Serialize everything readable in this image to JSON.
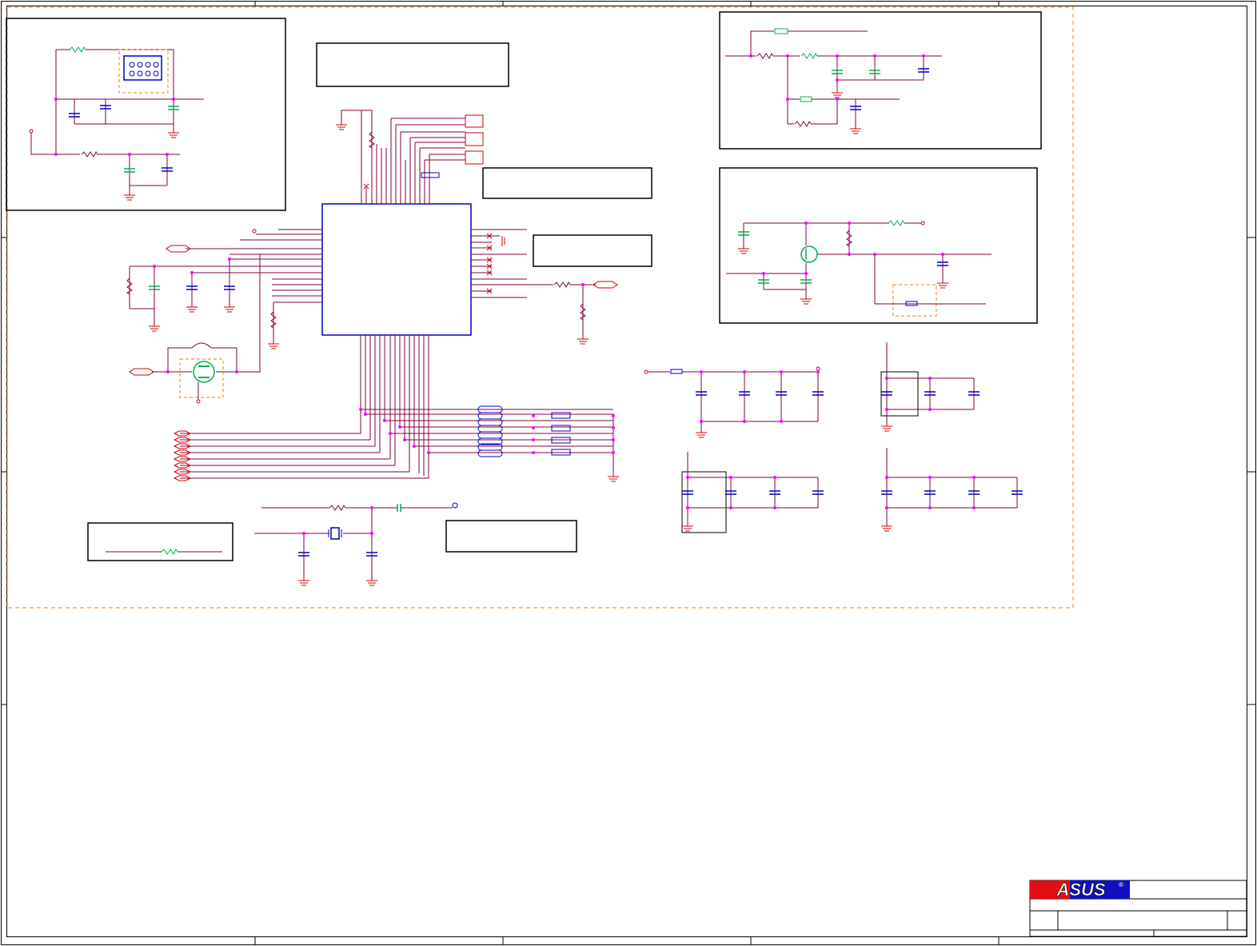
{
  "sheet": {
    "title": "",
    "company_logo": "ASUS",
    "registered_mark": "®"
  },
  "colors": {
    "wire": "#800040",
    "net_label": "#d00000",
    "part": "#0000c0",
    "part_alt": "#00b050",
    "junction": "#ff00ff",
    "frame": "#000000",
    "dashed_group": "#f08000",
    "logo_red": "#e01010",
    "logo_blue": "#1010c0"
  },
  "icons": {
    "resistor": "resistor-icon",
    "capacitor": "capacitor-icon",
    "ground": "ground-icon",
    "inductor": "inductor-icon",
    "transistor": "transistor-icon",
    "crystal": "crystal-icon",
    "connector": "connector-icon",
    "no_connect": "no-connect-icon"
  }
}
